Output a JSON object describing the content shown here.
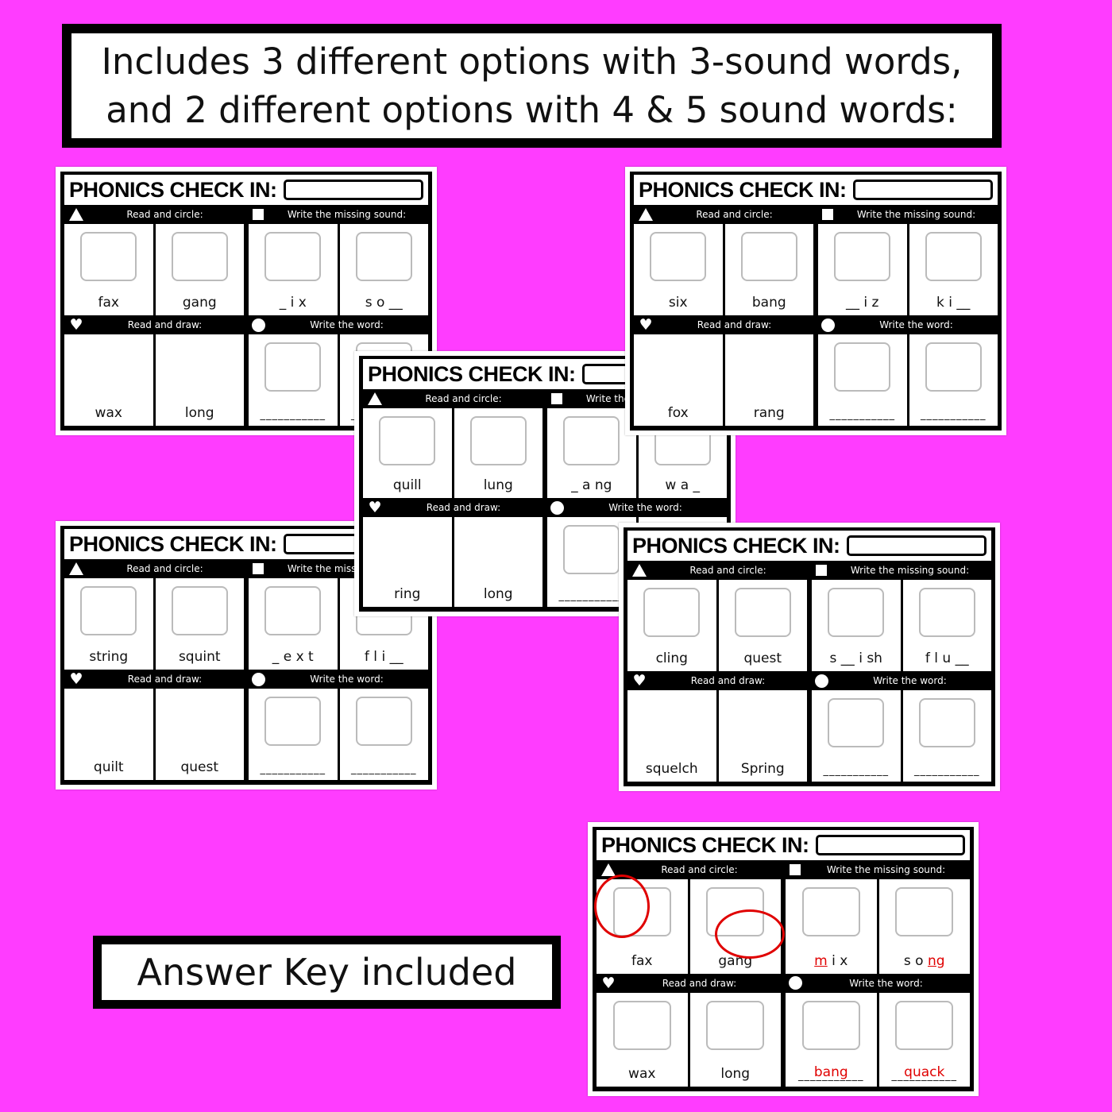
{
  "banner": {
    "line1": "Includes 3 different options with 3-sound words,",
    "line2": "and 2 different options with 4 & 5 sound words:"
  },
  "answer_key_label": "Answer Key included",
  "common": {
    "title": "PHONICS CHECK IN:",
    "read_circle": "Read and circle:",
    "missing_sound": "Write the missing sound:",
    "read_draw": "Read and draw:",
    "write_word": "Write the word:",
    "blank": "___________"
  },
  "colors": {
    "background": "#ff3cff",
    "answer": "#e00000"
  },
  "cards": [
    {
      "id": "a",
      "circle": [
        "fax",
        "gang"
      ],
      "missing": [
        [
          {
            "t": "_ i x"
          }
        ],
        [
          {
            "t": "s o __"
          }
        ]
      ],
      "draw": [
        "wax",
        "long"
      ],
      "write": [
        "",
        ""
      ]
    },
    {
      "id": "d",
      "circle": [
        "string",
        "squint"
      ],
      "missing": [
        [
          {
            "t": "_ e x t"
          }
        ],
        [
          {
            "t": "f l i __"
          }
        ]
      ],
      "draw": [
        "quilt",
        "quest"
      ],
      "write": [
        "",
        ""
      ]
    },
    {
      "id": "c",
      "circle": [
        "quill",
        "lung"
      ],
      "missing": [
        [
          {
            "t": "_ a ng"
          }
        ],
        [
          {
            "t": "w a _"
          }
        ]
      ],
      "draw": [
        "ring",
        "long"
      ],
      "write": [
        "",
        ""
      ]
    },
    {
      "id": "b",
      "circle": [
        "six",
        "bang"
      ],
      "missing": [
        [
          {
            "t": "__ i z"
          }
        ],
        [
          {
            "t": "k i __"
          }
        ]
      ],
      "draw": [
        "fox",
        "rang"
      ],
      "write": [
        "",
        ""
      ]
    },
    {
      "id": "e",
      "circle": [
        "cling",
        "quest"
      ],
      "missing": [
        [
          {
            "t": "s __ i sh"
          }
        ],
        [
          {
            "t": "f l u __"
          }
        ]
      ],
      "draw": [
        "squelch",
        "Spring"
      ],
      "write": [
        "",
        ""
      ]
    },
    {
      "id": "f",
      "answer": true,
      "circle": [
        "fax",
        "gang"
      ],
      "missing": [
        [
          {
            "t": "m",
            "red": true
          },
          {
            "t": " i x"
          }
        ],
        [
          {
            "t": "s o "
          },
          {
            "t": "ng",
            "red": true
          }
        ]
      ],
      "draw": [
        "wax",
        "long"
      ],
      "write": [
        "bang",
        "quack"
      ]
    }
  ]
}
